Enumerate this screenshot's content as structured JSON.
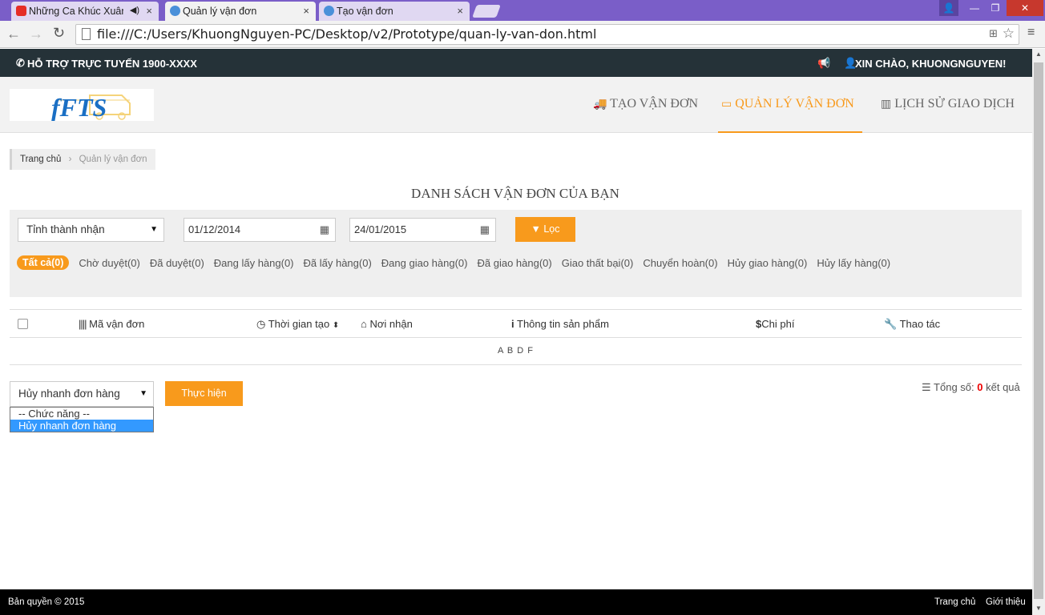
{
  "browser": {
    "tabs": [
      {
        "label": "Những Ca Khúc Xuân -",
        "favicon": "youtube-icon"
      },
      {
        "label": "Quản lý vận đơn",
        "favicon": "ffts-icon"
      },
      {
        "label": "Tạo vận đơn",
        "favicon": "ffts-icon"
      }
    ],
    "url": "file:///C:/Users/KhuongNguyen-PC/Desktop/v2/Prototype/quan-ly-van-don.html"
  },
  "topbar": {
    "support": "HỖ TRỢ TRỰC TUYẾN 1900-XXXX",
    "greeting": "XIN CHÀO, KHUONGNGUYEN!"
  },
  "logo": {
    "text": "fFTS"
  },
  "nav": {
    "create": "TẠO VẬN ĐƠN",
    "manage": "QUẢN LÝ VẬN ĐƠN",
    "history": "LỊCH SỬ GIAO DỊCH"
  },
  "breadcrumb": {
    "home": "Trang chủ",
    "separator": "›",
    "current": "Quản lý vận đơn"
  },
  "page_title": "DANH SÁCH VẬN ĐƠN CỦA BẠN",
  "filter": {
    "province": "Tỉnh thành nhận",
    "date_from": "01/12/2014",
    "date_to": "24/01/2015",
    "filter_button": "Lọc"
  },
  "statuses": [
    "Tất cả(0)",
    "Chờ duyệt(0)",
    "Đã duyệt(0)",
    "Đang lấy hàng(0)",
    "Đã lấy hàng(0)",
    "Đang giao hàng(0)",
    "Đã giao hàng(0)",
    "Giao thất bại(0)",
    "Chuyển hoàn(0)",
    "Hủy giao hàng(0)",
    "Hủy lấy hàng(0)"
  ],
  "table": {
    "columns": {
      "code": "Mã vận đơn",
      "time": "Thời gian tạo",
      "destination": "Nơi nhận",
      "product": "Thông tin sản phẩm",
      "cost": "Chi phí",
      "action": "Thao tác"
    },
    "body_text": "A B D F"
  },
  "bulk": {
    "selected": "Hủy nhanh đơn hàng",
    "options": [
      "-- Chức năng --",
      "Hủy nhanh đơn hàng"
    ],
    "execute": "Thực hiện"
  },
  "total": {
    "label": "Tổng số:",
    "count": "0",
    "suffix": "kết quả"
  },
  "footer": {
    "copyright": "Bản quyền © 2015",
    "links": [
      "Trang chủ",
      "Giới thiệu"
    ]
  },
  "colors": {
    "accent": "#f89a1c",
    "topbar": "#253238",
    "selection": "#3399ff"
  }
}
